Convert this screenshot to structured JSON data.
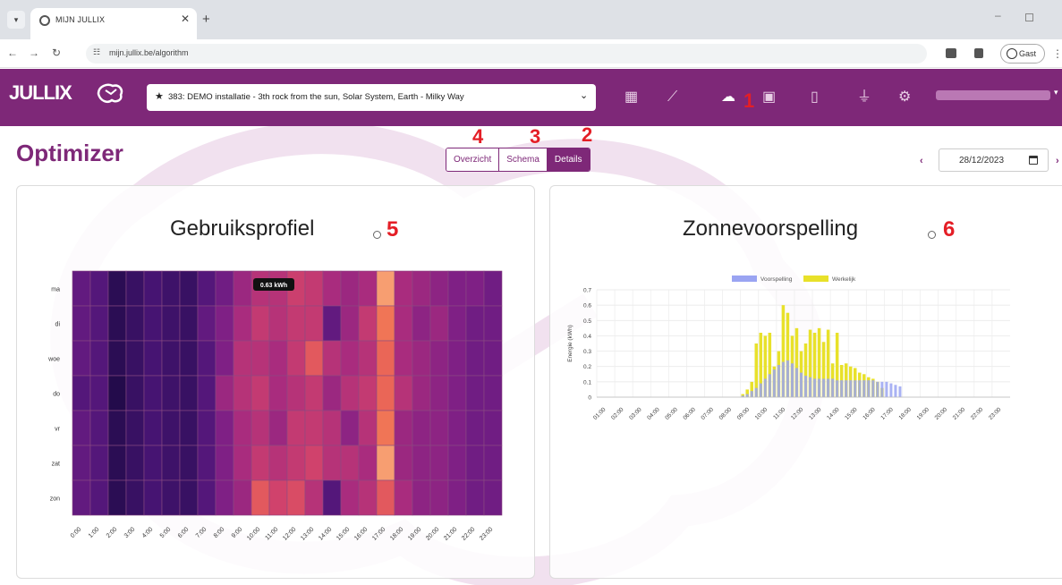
{
  "browser": {
    "tab_title": "MIJN JULLIX",
    "url": "mijn.jullix.be/algorithm",
    "guest_label": "Gast"
  },
  "header": {
    "logo_text": "JULLIX",
    "installation": "383: DEMO installatie - 3th rock from the sun, Solar System, Earth - Milky Way",
    "nav_icons": [
      "dashboard-icon",
      "chart-icon",
      "brain-icon",
      "battery-screen-icon",
      "ev-charger-icon",
      "plug-icon",
      "gear-icon"
    ],
    "accent": "#7e2878"
  },
  "annotations": [
    "1",
    "2",
    "3",
    "4",
    "5",
    "6"
  ],
  "page": {
    "title": "Optimizer",
    "tabs": [
      {
        "label": "Overzicht",
        "active": false
      },
      {
        "label": "Schema",
        "active": false
      },
      {
        "label": "Details",
        "active": true
      }
    ],
    "date": "28/12/2023"
  },
  "heatmap_card": {
    "title": "Gebruiksprofiel",
    "tooltip": "0.63 kWh"
  },
  "solar_card": {
    "title": "Zonnevoorspelling"
  },
  "chart_data": [
    {
      "type": "heatmap",
      "title": "Gebruiksprofiel",
      "rows": [
        "ma",
        "di",
        "woe",
        "do",
        "vr",
        "zat",
        "zon"
      ],
      "columns": [
        "0:00",
        "1:00",
        "2:00",
        "3:00",
        "4:00",
        "5:00",
        "6:00",
        "7:00",
        "8:00",
        "9:00",
        "10:00",
        "11:00",
        "12:00",
        "13:00",
        "14:00",
        "15:00",
        "16:00",
        "17:00",
        "18:00",
        "19:00",
        "20:00",
        "21:00",
        "22:00",
        "23:00"
      ],
      "colorscale": [
        "#1e0a45",
        "#4a1577",
        "#7a1f86",
        "#a92c7e",
        "#d4446a",
        "#ef6e52",
        "#fbb27e"
      ],
      "values": [
        [
          0.25,
          0.2,
          0.05,
          0.1,
          0.15,
          0.12,
          0.1,
          0.2,
          0.3,
          0.45,
          0.55,
          0.55,
          0.63,
          0.6,
          0.5,
          0.45,
          0.5,
          0.95,
          0.5,
          0.45,
          0.4,
          0.35,
          0.35,
          0.3
        ],
        [
          0.25,
          0.2,
          0.05,
          0.1,
          0.15,
          0.12,
          0.1,
          0.25,
          0.35,
          0.5,
          0.6,
          0.55,
          0.6,
          0.6,
          0.25,
          0.45,
          0.6,
          0.85,
          0.5,
          0.4,
          0.45,
          0.35,
          0.3,
          0.3
        ],
        [
          0.25,
          0.2,
          0.05,
          0.1,
          0.15,
          0.12,
          0.1,
          0.2,
          0.35,
          0.55,
          0.55,
          0.5,
          0.6,
          0.75,
          0.55,
          0.5,
          0.55,
          0.8,
          0.5,
          0.45,
          0.4,
          0.35,
          0.3,
          0.3
        ],
        [
          0.2,
          0.2,
          0.02,
          0.1,
          0.15,
          0.12,
          0.1,
          0.2,
          0.45,
          0.55,
          0.6,
          0.5,
          0.55,
          0.6,
          0.45,
          0.55,
          0.6,
          0.8,
          0.55,
          0.45,
          0.4,
          0.35,
          0.3,
          0.3
        ],
        [
          0.25,
          0.2,
          0.05,
          0.1,
          0.15,
          0.12,
          0.1,
          0.2,
          0.35,
          0.5,
          0.55,
          0.45,
          0.6,
          0.6,
          0.55,
          0.4,
          0.55,
          0.85,
          0.45,
          0.4,
          0.4,
          0.35,
          0.3,
          0.3
        ],
        [
          0.25,
          0.2,
          0.05,
          0.1,
          0.15,
          0.12,
          0.1,
          0.2,
          0.35,
          0.5,
          0.6,
          0.55,
          0.6,
          0.65,
          0.55,
          0.55,
          0.5,
          0.95,
          0.45,
          0.4,
          0.4,
          0.35,
          0.3,
          0.3
        ],
        [
          0.25,
          0.2,
          0.05,
          0.1,
          0.15,
          0.12,
          0.1,
          0.2,
          0.35,
          0.45,
          0.75,
          0.65,
          0.7,
          0.55,
          0.2,
          0.5,
          0.55,
          0.75,
          0.5,
          0.4,
          0.4,
          0.35,
          0.3,
          0.3
        ]
      ]
    },
    {
      "type": "bar",
      "title": "Zonnevoorspelling",
      "ylabel": "Energie (kWh)",
      "ylim": [
        0,
        0.7
      ],
      "yticks": [
        0,
        0.1,
        0.2,
        0.3,
        0.4,
        0.5,
        0.6,
        0.7
      ],
      "grid": true,
      "legend_position": "top",
      "x_tick_labels": [
        "01:00",
        "02:00",
        "03:00",
        "04:00",
        "05:00",
        "06:00",
        "07:00",
        "08:00",
        "09:00",
        "10:00",
        "11:00",
        "12:00",
        "13:00",
        "14:00",
        "15:00",
        "16:00",
        "17:00",
        "18:00",
        "19:00",
        "20:00",
        "21:00",
        "22:00",
        "23:00"
      ],
      "bins_per_hour": 4,
      "x_start_hour": 1,
      "series": [
        {
          "name": "Voorspelling",
          "color": "#9aa4f2",
          "values": [
            0,
            0,
            0,
            0,
            0,
            0,
            0,
            0,
            0,
            0,
            0,
            0,
            0,
            0,
            0,
            0,
            0,
            0,
            0,
            0,
            0,
            0,
            0,
            0,
            0,
            0,
            0,
            0,
            0,
            0,
            0,
            0,
            0.01,
            0.02,
            0.04,
            0.06,
            0.09,
            0.12,
            0.15,
            0.18,
            0.21,
            0.23,
            0.24,
            0.22,
            0.19,
            0.16,
            0.14,
            0.13,
            0.12,
            0.12,
            0.12,
            0.12,
            0.12,
            0.11,
            0.11,
            0.11,
            0.11,
            0.11,
            0.11,
            0.11,
            0.11,
            0.11,
            0.1,
            0.1,
            0.1,
            0.09,
            0.08,
            0.07,
            0,
            0,
            0,
            0,
            0,
            0,
            0,
            0,
            0,
            0,
            0,
            0,
            0,
            0,
            0,
            0,
            0,
            0,
            0,
            0,
            0,
            0,
            0,
            0
          ]
        },
        {
          "name": "Werkelijk",
          "color": "#e8e12a",
          "values": [
            0,
            0,
            0,
            0,
            0,
            0,
            0,
            0,
            0,
            0,
            0,
            0,
            0,
            0,
            0,
            0,
            0,
            0,
            0,
            0,
            0,
            0,
            0,
            0,
            0,
            0,
            0,
            0,
            0,
            0,
            0,
            0,
            0.02,
            0.05,
            0.1,
            0.35,
            0.42,
            0.4,
            0.42,
            0.2,
            0.3,
            0.6,
            0.55,
            0.4,
            0.45,
            0.3,
            0.35,
            0.44,
            0.42,
            0.45,
            0.36,
            0.44,
            0.22,
            0.42,
            0.21,
            0.22,
            0.2,
            0.19,
            0.16,
            0.15,
            0.13,
            0.12,
            0.1,
            0.06,
            0,
            0,
            0,
            0,
            0,
            0,
            0,
            0,
            0,
            0,
            0,
            0,
            0,
            0,
            0,
            0,
            0,
            0,
            0,
            0,
            0,
            0,
            0,
            0,
            0,
            0,
            0,
            0
          ]
        }
      ]
    }
  ]
}
